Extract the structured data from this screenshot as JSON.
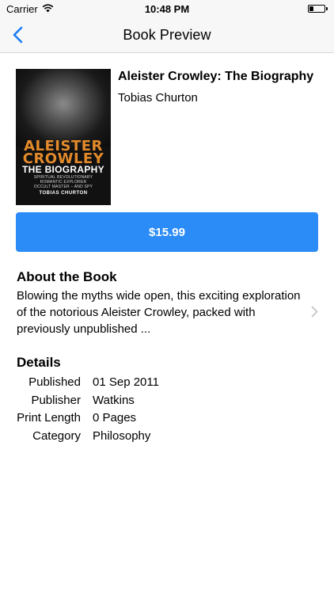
{
  "status_bar": {
    "carrier": "Carrier",
    "time": "10:48 PM",
    "battery_level": 0.25
  },
  "nav": {
    "title": "Book Preview",
    "back_icon": "chevron-left-icon",
    "accent_color": "#1a7cf4"
  },
  "book": {
    "title": "Aleister Crowley: The Biography",
    "author": "Tobias Churton",
    "cover": {
      "title_line1": "ALEISTER",
      "title_line2": "CROWLEY",
      "subtitle_main": "THE BIOGRAPHY",
      "subtitle_lines": [
        "SPIRITUAL REVOLUTIONARY",
        "ROMANTIC EXPLORER",
        "OCCULT MASTER – AND SPY"
      ],
      "author": "TOBIAS CHURTON"
    }
  },
  "price_button": {
    "label": "$15.99",
    "color": "#2b8cf7"
  },
  "about": {
    "heading": "About the Book",
    "text": "Blowing the myths wide open, this exciting exploration of the notorious Aleister Crowley, packed with previously unpublished ..."
  },
  "details": {
    "heading": "Details",
    "rows": [
      {
        "label": "Published",
        "value": "01 Sep 2011"
      },
      {
        "label": "Publisher",
        "value": "Watkins"
      },
      {
        "label": "Print Length",
        "value": "0 Pages"
      },
      {
        "label": "Category",
        "value": "Philosophy"
      }
    ]
  }
}
